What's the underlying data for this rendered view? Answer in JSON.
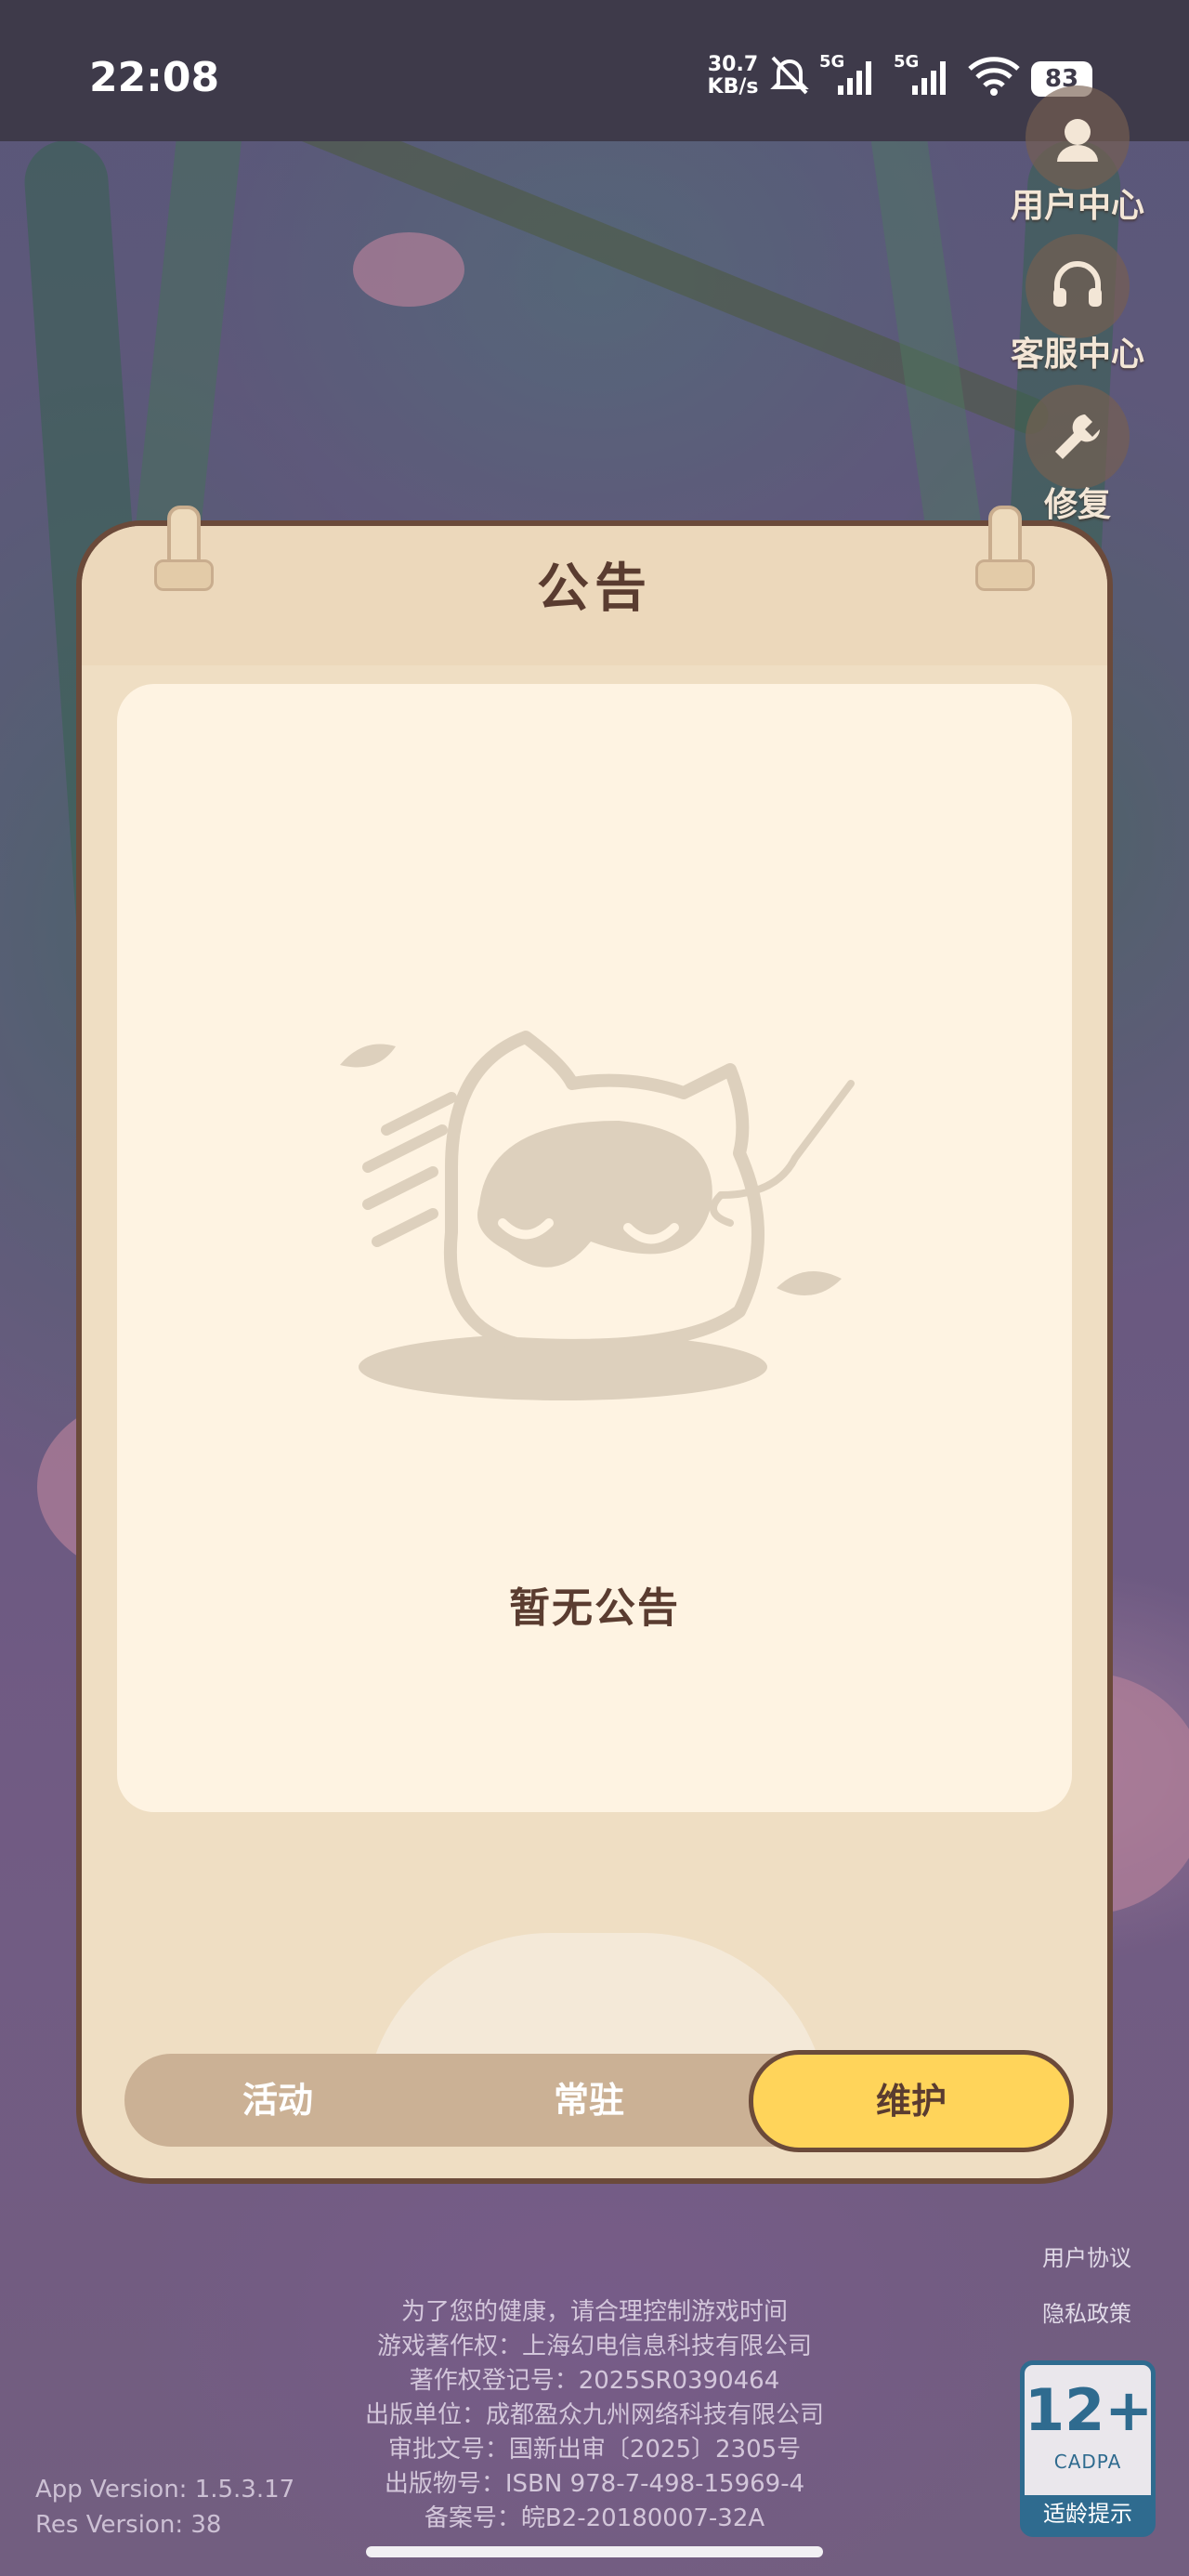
{
  "status_bar": {
    "time": "22:08",
    "net_speed": "30.7 KB/s",
    "battery": "83",
    "signal_labels": [
      "5G",
      "5G"
    ]
  },
  "side_menu": [
    {
      "label": "用户中心",
      "icon": "user-icon"
    },
    {
      "label": "客服中心",
      "icon": "headset-icon"
    },
    {
      "label": "修复",
      "icon": "wrench-icon"
    }
  ],
  "panel": {
    "title": "公告",
    "empty_text": "暂无公告",
    "tabs": [
      {
        "label": "活动",
        "active": false
      },
      {
        "label": "常驻",
        "active": false
      },
      {
        "label": "维护",
        "active": true
      }
    ]
  },
  "footer": {
    "legal_lines": [
      "为了您的健康，请合理控制游戏时间",
      "游戏著作权：上海幻电信息科技有限公司",
      "著作权登记号：2025SR0390464",
      "出版单位：成都盈众九州网络科技有限公司",
      "审批文号：国新出审〔2025〕2305号",
      "出版物号：ISBN 978-7-498-15969-4",
      "备案号：皖B2-20180007-32A"
    ],
    "app_version": "App Version: 1.5.3.17",
    "res_version": "Res Version: 38",
    "user_agreement": "用户协议",
    "privacy_policy": "隐私政策",
    "age_rating": {
      "number": "12+",
      "org": "CADPA",
      "tip": "适龄提示"
    }
  },
  "colors": {
    "panel_bg": "#efdec3",
    "card_bg": "#fef3e2",
    "active_tab": "#ffd45a",
    "border": "#6b4a3a",
    "text_dark": "#5a3c30"
  }
}
